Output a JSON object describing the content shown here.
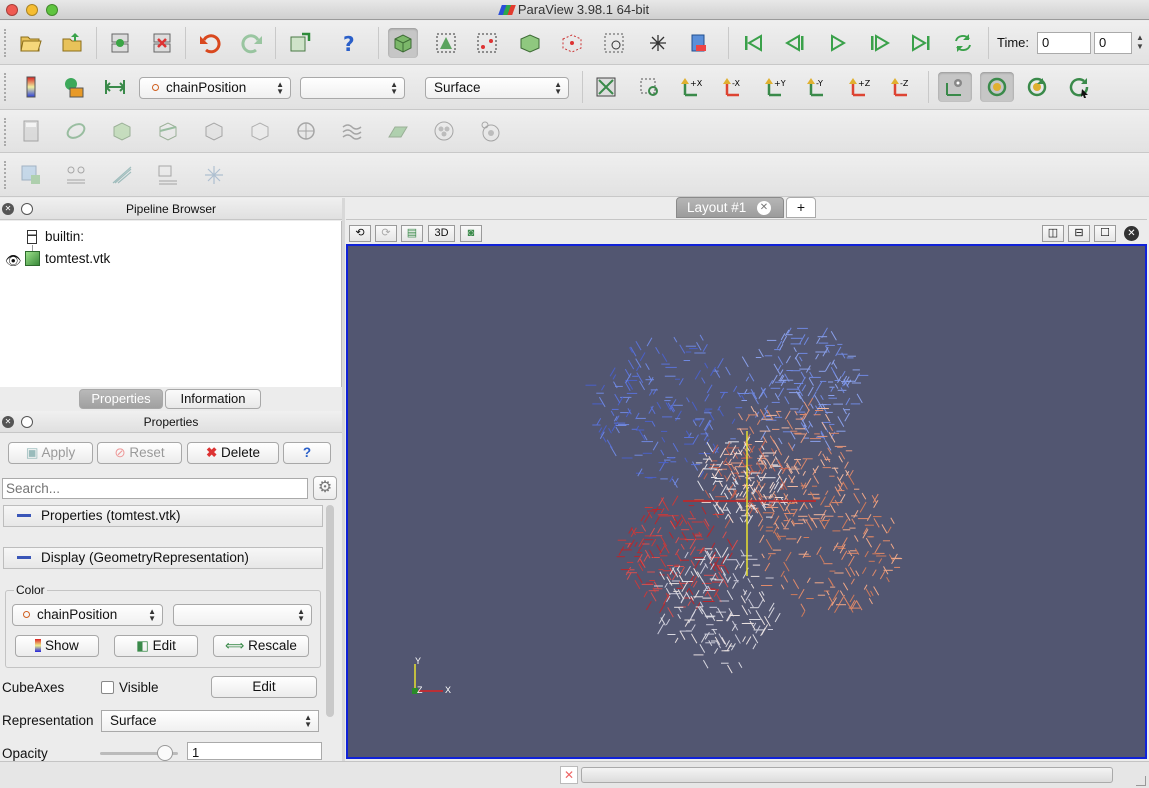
{
  "window": {
    "title": "ParaView 3.98.1 64-bit"
  },
  "toolbar_main": {
    "time_label": "Time:",
    "time_value": "0",
    "time_step": "0",
    "icons": [
      "open-icon",
      "load-state-icon",
      "connect-icon",
      "disconnect-icon",
      "undo-icon",
      "redo-icon",
      "reset-session-icon",
      "help-icon",
      "interact-icon",
      "select-cells-icon",
      "select-points-icon",
      "select-cells-frustum-icon",
      "select-points-frustum-icon",
      "select-block-icon",
      "interactive-select-icon",
      "clear-selection-icon",
      "first-frame-icon",
      "previous-frame-icon",
      "play-icon",
      "next-frame-icon",
      "last-frame-icon",
      "loop-icon"
    ]
  },
  "toolbar_display": {
    "color_by": "chainPosition",
    "component": "",
    "representation": "Surface",
    "camera_buttons": [
      "+X",
      "-X",
      "+Y",
      "-Y",
      "+Z",
      "-Z"
    ]
  },
  "pipeline": {
    "title": "Pipeline Browser",
    "items": [
      {
        "label": "builtin:"
      },
      {
        "label": "tomtest.vtk"
      }
    ]
  },
  "tabs": [
    {
      "label": "Properties"
    },
    {
      "label": "Information"
    }
  ],
  "properties": {
    "title": "Properties",
    "apply": "Apply",
    "reset": "Reset",
    "delete": "Delete",
    "help": "?",
    "search_placeholder": "Search...",
    "section_props": "Properties (tomtest.vtk)",
    "section_display": "Display (GeometryRepresentation)",
    "color_label": "Color",
    "color_by": "chainPosition",
    "color_component": "",
    "show": "Show",
    "edit": "Edit",
    "rescale": "Rescale",
    "cube_axes_label": "CubeAxes",
    "visible_label": "Visible",
    "cube_edit": "Edit",
    "representation_label": "Representation",
    "representation": "Surface",
    "opacity_label": "Opacity",
    "opacity": 1,
    "opacity_value": "1"
  },
  "layout": {
    "tab": "Layout #1",
    "add": "+",
    "view_3d": "3D"
  },
  "axes": {
    "y": "Y",
    "z": "Z",
    "x": "X"
  },
  "colors": {
    "view_bg": "#525671",
    "view_border": "#1022d8"
  }
}
